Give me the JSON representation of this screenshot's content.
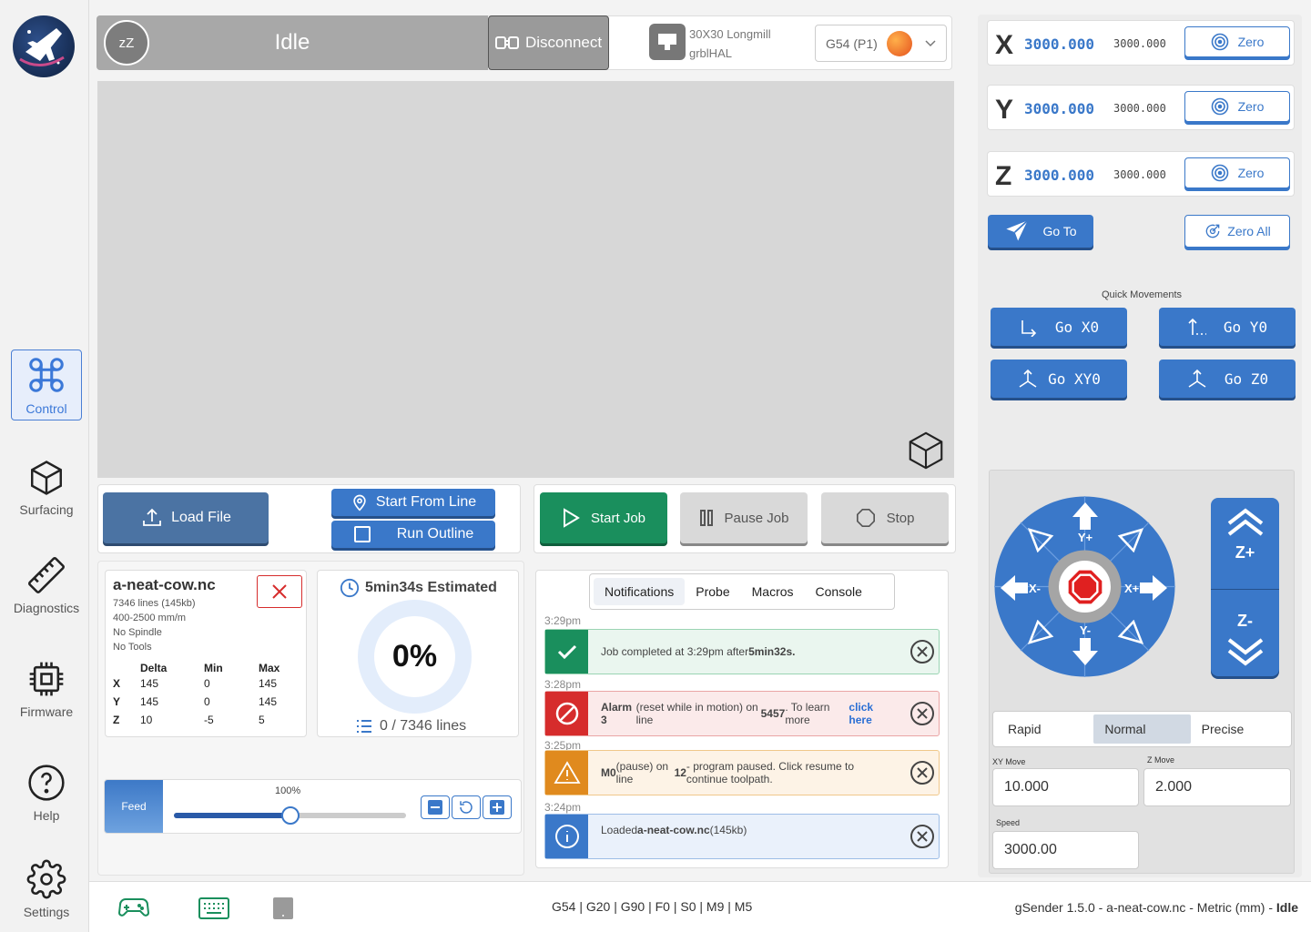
{
  "sidebar": {
    "items": [
      {
        "label": "Control",
        "icon": "command-icon",
        "active": true
      },
      {
        "label": "Surfacing",
        "icon": "cube-icon"
      },
      {
        "label": "Diagnostics",
        "icon": "ruler-icon"
      },
      {
        "label": "Firmware",
        "icon": "chip-icon"
      },
      {
        "label": "Help",
        "icon": "help-icon"
      },
      {
        "label": "Settings",
        "icon": "gear-icon"
      }
    ]
  },
  "topbar": {
    "state_icon_text": "zZ",
    "state": "Idle",
    "disconnect_label": "Disconnect",
    "machine_line1": "30X30 Longmill",
    "machine_line2": "grblHAL",
    "workspace": "G54 (P1)"
  },
  "file_actions": {
    "load_file": "Load File",
    "start_from_line": "Start From Line",
    "run_outline": "Run Outline"
  },
  "job_actions": {
    "start_job": "Start Job",
    "pause_job": "Pause Job",
    "stop": "Stop"
  },
  "file_info": {
    "name": "a-neat-cow.nc",
    "lines": "7346 lines (145kb)",
    "feed_range": "400-2500 mm/m",
    "spindle": "No Spindle",
    "tools": "No Tools",
    "headers": [
      "Delta",
      "Min",
      "Max"
    ],
    "rows": [
      {
        "axis": "X",
        "delta": "145",
        "min": "0",
        "max": "145"
      },
      {
        "axis": "Y",
        "delta": "145",
        "min": "0",
        "max": "145"
      },
      {
        "axis": "Z",
        "delta": "10",
        "min": "-5",
        "max": "5"
      }
    ]
  },
  "progress": {
    "estimate": "5min34s Estimated",
    "percent": "0%",
    "lines": "0 / 7346 lines",
    "value": 0
  },
  "feed": {
    "label": "Feed",
    "percent_text": "100%",
    "slider_fraction": 0.5
  },
  "tabs": [
    "Notifications",
    "Probe",
    "Macros",
    "Console"
  ],
  "notifications": [
    {
      "time": "3:29pm",
      "type": "success",
      "html": "Job completed at 3:29pm after <b>5min32s.</b>"
    },
    {
      "time": "3:28pm",
      "type": "error",
      "html": "<b>Alarm 3</b> (reset while in motion) on line <b>5457</b>.  To learn more <a style=\"color:#2a6fd4;font-weight:bold;text-decoration:none\">click here</a>"
    },
    {
      "time": "3:25pm",
      "type": "warning",
      "html": "<b>M0</b> (pause) on line <b>12</b> - program paused.  Click resume to continue toolpath."
    },
    {
      "time": "3:24pm",
      "type": "info",
      "html": "Loaded <b>a-neat-cow.nc</b> (145kb)"
    }
  ],
  "dro": {
    "axes": [
      {
        "axis": "X",
        "work": "3000.000",
        "machine": "3000.000",
        "zero": "Zero"
      },
      {
        "axis": "Y",
        "work": "3000.000",
        "machine": "3000.000",
        "zero": "Zero"
      },
      {
        "axis": "Z",
        "work": "3000.000",
        "machine": "3000.000",
        "zero": "Zero"
      }
    ],
    "goto": "Go To",
    "zero_all": "Zero All"
  },
  "quick": {
    "title": "Quick Movements",
    "buttons": [
      "Go X0",
      "Go Y0",
      "Go XY0",
      "Go Z0"
    ]
  },
  "jog": {
    "y_plus": "Y+",
    "y_minus": "Y-",
    "x_plus": "X+",
    "x_minus": "X-",
    "z_plus": "Z+",
    "z_minus": "Z-",
    "modes": [
      "Rapid",
      "Normal",
      "Precise"
    ],
    "active_mode": "Normal",
    "xy_label": "XY Move",
    "xy_value": "10.000",
    "z_label": "Z Move",
    "z_value": "2.000",
    "speed_label": "Speed",
    "speed_value": "3000.00"
  },
  "status_bar": {
    "gcode": "G54 | G20 | G90 | F0 | S0 | M9 | M5",
    "summary": "gSender 1.5.0 - a-neat-cow.nc - Metric (mm) - ",
    "state": "Idle"
  },
  "colors": {
    "primary": "#3a78c9",
    "success": "#1e9a5a",
    "error": "#d62c2c",
    "warning": "#e08a1e",
    "info": "#3a78c9"
  }
}
